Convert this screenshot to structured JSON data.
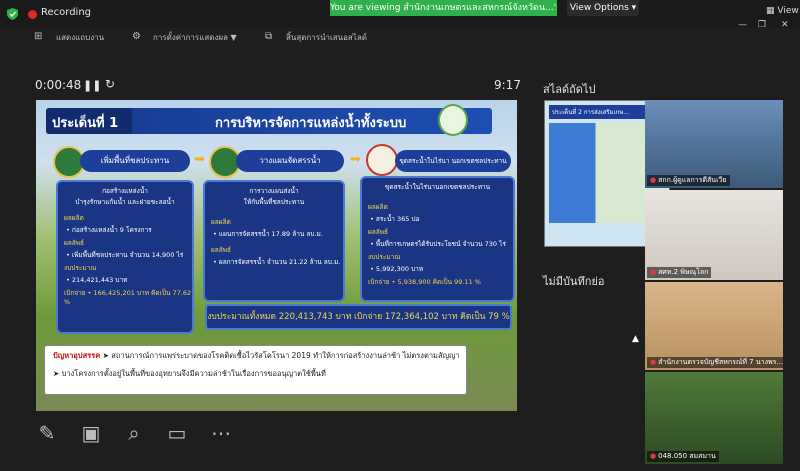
{
  "topbar": {
    "recording_label": "Recording",
    "share_banner": "You are viewing สำนักงานเกษตรและสหกรณ์จังหวัดน...'s screen",
    "view_options_label": "View Options ▾",
    "view_label": "View"
  },
  "toolbar": {
    "item1": "แสดงแถบงาน",
    "item2": "การตั้งค่าการแสดงผล ▼",
    "item3": "สิ้นสุดการนำเสนอสไลด์"
  },
  "presenter": {
    "elapsed": "0:00:48",
    "clock": "9:17"
  },
  "slide": {
    "number": "ประเด็นที่ 1",
    "title": "การบริหารจัดการแหล่งน้ำทั้งระบบ",
    "pills": [
      "เพิ่มพื้นที่ชลประทาน",
      "วางแผนจัดสรรน้ำ",
      "ขุดสระน้ำในไร่นา นอกเขตชลประทาน"
    ],
    "panel1": {
      "head1": "ก่อสร้างแหล่งน้ำ",
      "head2": "บำรุงรักษาแก้มน้ำ และฝายชะลอน้ำ",
      "label_output": "ผลผลิต",
      "output": "• ก่อสร้างแหล่งน้ำ 9 โครงการ",
      "label_outcome": "ผลลัพธ์",
      "outcome": "• เพิ่มพื้นที่ชลประทาน จำนวน 14,900 ไร่",
      "label_budget": "งบประมาณ",
      "budget": "• 214,421,443 บาท",
      "spent": "เบิกจ่าย • 166,425,201 บาท คิดเป็น 77.62 %"
    },
    "panel2": {
      "head1": "การวางแผนส่งน้ำ",
      "head2": "ให้กับพื้นที่ชลประทาน",
      "label_output": "ผลผลิต",
      "output": "• แผนการจัดสรรน้ำ 17.89 ล้าน ลบ.ม.",
      "label_outcome": "ผลลัพธ์",
      "outcome": "• ผลการจัดสรรน้ำ จำนวน 21.22 ล้าน ลบ.ม."
    },
    "panel3": {
      "head1": "ขุดสระน้ำในไร่นานอกเขตชลประทาน",
      "label_output": "ผลผลิต",
      "output": "• สระน้ำ 365 บ่อ",
      "label_outcome": "ผลลัพธ์",
      "outcome": "• พื้นที่การเกษตรได้รับประโยชน์ จำนวน 730 ไร่",
      "label_budget": "งบประมาณ",
      "budget": "• 5,992,300 บาท",
      "spent": "เบิกจ่าย • 5,938,900 คิดเป็น 99.11 %"
    },
    "total_budget": "งบประมาณทั้งหมด 220,413,743 บาท เบิกจ่าย 172,364,102 บาท คิดเป็น 79 %",
    "problem_lead": "ปัญหาอุปสรรค",
    "problem_line1": "สถานการณ์การแพร่ระบาดของโรคติดเชื้อไวรัสโคโรนา 2019 ทำให้การก่อสร้างงานล่าช้า ไม่ตรงตามสัญญา",
    "problem_line2": "บางโครงการตั้งอยู่ในพื้นที่ของอุทยานจึงมีความล่าช้าในเรื่องการขออนุญาตใช้พื้นที่"
  },
  "side": {
    "next_slide_label": "สไลด์ถัดไป",
    "next_slide_title": "ประเด็นที่ 2 การส่งเสริมเกษ...",
    "notes_label": "ไม่มีบันทึกย่อ"
  },
  "participants": [
    {
      "name": "สกก.ผู้ดูแลการดีสันเวีย"
    },
    {
      "name": "สศท.2 พิษณุโลก"
    },
    {
      "name": "สำนักงานตรวจบัญชีสหกรณ์ที่ 7 นางพร..."
    },
    {
      "name": "048.050 สมสมาน"
    }
  ],
  "colors": {
    "banner_green": "#2fb14c",
    "recording_red": "#e02828",
    "slide_navy": "#1b3585",
    "highlight_yellow": "#f3d44c"
  }
}
